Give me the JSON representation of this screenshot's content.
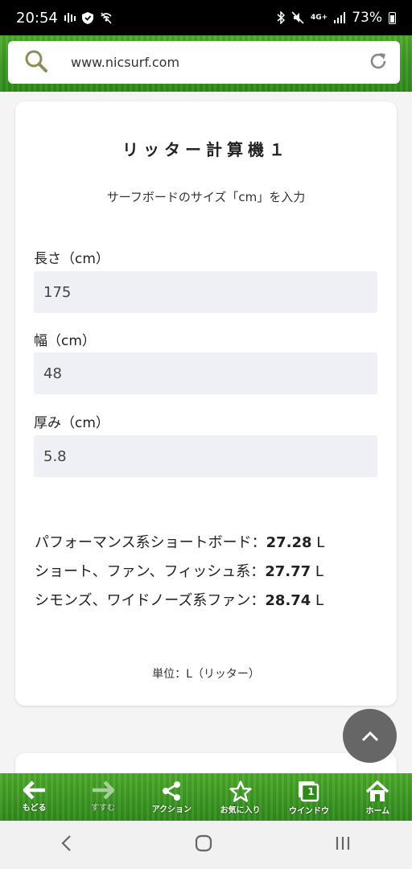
{
  "status_bar": {
    "time": "20:54",
    "network": "4G+",
    "battery": "73%"
  },
  "browser": {
    "url": "www.nicsurf.com"
  },
  "calculator": {
    "title": "リッター計算機１",
    "subtitle": "サーフボードのサイズ「cm」を入力",
    "fields": [
      {
        "label": "長さ（cm）",
        "value": "175"
      },
      {
        "label": "幅（cm）",
        "value": "48"
      },
      {
        "label": "厚み（cm）",
        "value": "5.8"
      }
    ],
    "results": [
      {
        "label": "パフォーマンス系ショートボード：",
        "value": "27.28",
        "unit": " L"
      },
      {
        "label": "ショート、ファン、フィッシュ系：",
        "value": "27.77",
        "unit": " L"
      },
      {
        "label": "シモンズ、ワイドノーズ系ファン：",
        "value": "28.74",
        "unit": " L"
      }
    ],
    "unit_note": "単位：L（リッター）"
  },
  "toolbar": {
    "items": [
      {
        "label": "もどる",
        "icon": "back-arrow-icon"
      },
      {
        "label": "すすむ",
        "icon": "forward-arrow-icon"
      },
      {
        "label": "アクション",
        "icon": "share-icon"
      },
      {
        "label": "お気に入り",
        "icon": "star-icon"
      },
      {
        "label": "ウインドウ",
        "icon": "window-icon",
        "badge": "1"
      },
      {
        "label": "ホーム",
        "icon": "home-icon"
      }
    ]
  },
  "colors": {
    "grass_green": "#3b9622",
    "input_bg": "#eef0f5",
    "scroll_button": "#666666"
  }
}
